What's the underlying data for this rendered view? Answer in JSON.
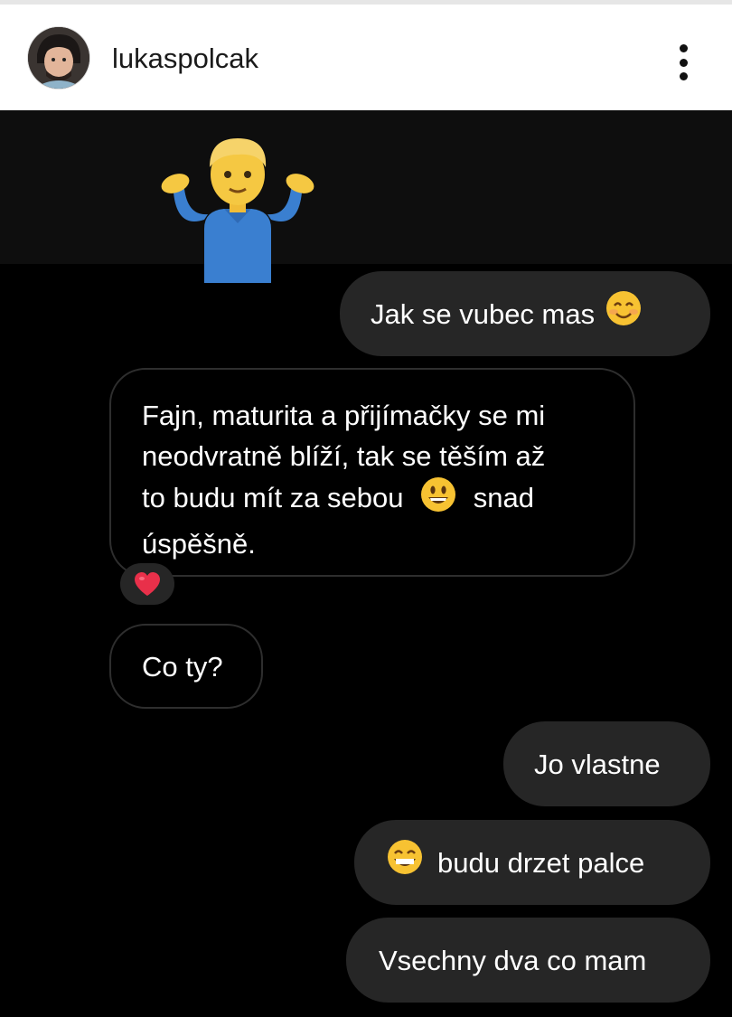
{
  "header": {
    "username": "lukaspolcak"
  },
  "colors": {
    "outgoing_bubble": "#262626",
    "incoming_border": "#2e2e2e",
    "background": "#000000"
  },
  "messages": [
    {
      "direction": "outgoing",
      "text": "Jak se vubec mas",
      "emoji": "smiling-face-icon"
    },
    {
      "direction": "incoming",
      "lines": [
        "Fajn, maturita a přijímačky se mi",
        "neodvratně blíží, tak se těším až",
        "to budu mít za sebou",
        "snad",
        "úspěšně."
      ],
      "emoji": "grinning-face-icon",
      "reaction": "heart-icon"
    },
    {
      "direction": "incoming",
      "text": "Co ty?"
    },
    {
      "direction": "outgoing",
      "text": "Jo vlastne"
    },
    {
      "direction": "outgoing",
      "text": "budu drzet palce",
      "emoji": "beaming-face-icon"
    },
    {
      "direction": "outgoing",
      "text": "Vsechny dva co mam"
    }
  ]
}
